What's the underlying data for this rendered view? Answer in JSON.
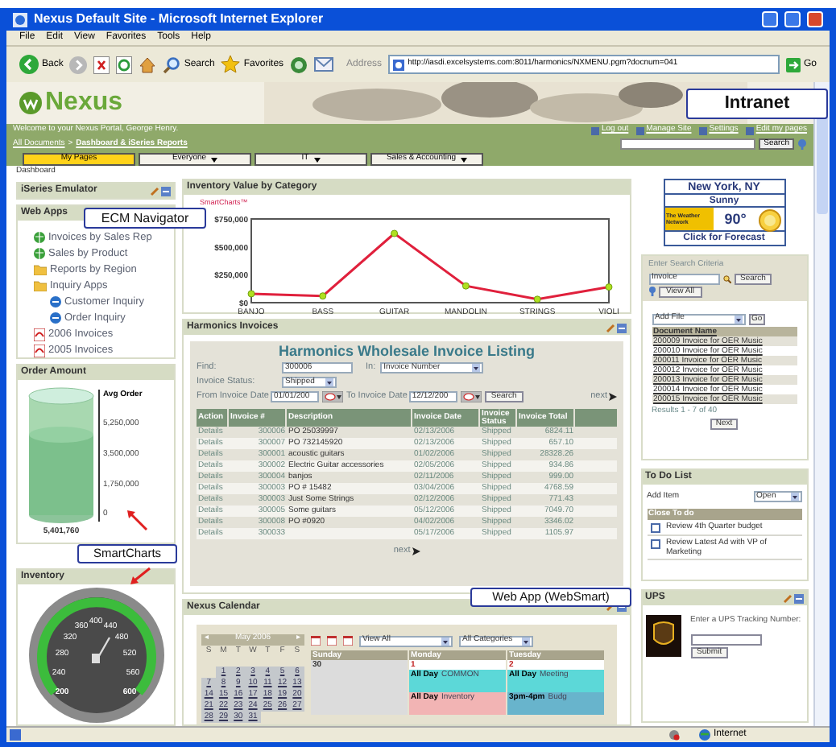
{
  "window": {
    "title": "Nexus Default Site - Microsoft Internet Explorer"
  },
  "menu": [
    "File",
    "Edit",
    "View",
    "Favorites",
    "Tools",
    "Help"
  ],
  "toolbar": {
    "back": "Back",
    "search": "Search",
    "favorites": "Favorites",
    "address_label": "Address",
    "address": "http://iasdi.excelsystems.com:8011/harmonics/NXMENU.pgm?docnum=041",
    "go": "Go"
  },
  "banner": {
    "logo": "Nexus",
    "callout": "Intranet"
  },
  "portal_bar": {
    "welcome": "Welcome to your Nexus Portal, George Henry.",
    "links": [
      "Log out",
      "Manage Site",
      "Settings",
      "Edit my pages"
    ],
    "breadcrumb": [
      "All Documents",
      ">",
      "Dashboard & iSeries Reports"
    ],
    "search_button": "Search"
  },
  "tabs": [
    {
      "label": "My Pages",
      "selected": true,
      "dropdown": false
    },
    {
      "label": "Everyone",
      "selected": false,
      "dropdown": true
    },
    {
      "label": "IT",
      "selected": false,
      "dropdown": true
    },
    {
      "label": "Sales & Accounting",
      "selected": false,
      "dropdown": true
    }
  ],
  "left": {
    "dashboard_label": "Dashboard",
    "iseries_title": "iSeries Emulator",
    "callout": "ECM Navigator",
    "web_apps": {
      "title": "Web Apps",
      "items": [
        {
          "label": "Invoices by Sales Rep",
          "kind": "globe"
        },
        {
          "label": "Sales by Product",
          "kind": "globe"
        },
        {
          "label": "Reports by Region",
          "kind": "folder"
        },
        {
          "label": "Inquiry Apps",
          "kind": "folder",
          "children": [
            {
              "label": "Customer Inquiry",
              "kind": "app"
            },
            {
              "label": "Order Inquiry",
              "kind": "app"
            }
          ]
        },
        {
          "label": "2006 Invoices",
          "kind": "pdf"
        },
        {
          "label": "2005 Invoices",
          "kind": "pdf"
        }
      ]
    },
    "order_amount": {
      "title": "Order Amount",
      "axis_title": "Avg Order",
      "ticks": [
        "5,250,000",
        "3,500,000",
        "1,750,000",
        "0"
      ],
      "value": "5,401,760"
    },
    "smartcharts_callout": "SmartCharts",
    "inventory": {
      "title": "Inventory",
      "gauge_labels": [
        "400",
        "360",
        "440",
        "320",
        "480",
        "280",
        "520",
        "240",
        "560",
        "200",
        "600"
      ]
    }
  },
  "inventory_chart": {
    "title": "Inventory Value by Category",
    "brand": "SmartCharts™",
    "chart_data": {
      "type": "line",
      "categories": [
        "BANJO",
        "BASS",
        "GUITAR",
        "MANDOLIN",
        "STRINGS",
        "VIOLI"
      ],
      "series": [
        {
          "color": "#e0203c",
          "marker": "circle",
          "values": [
            80000,
            60000,
            620000,
            150000,
            30000,
            140000
          ]
        }
      ],
      "ylim": [
        0,
        750000
      ],
      "yticks": [
        {
          "value": 0,
          "label": "$0"
        },
        {
          "value": 250000,
          "label": "$250,000"
        },
        {
          "value": 500000,
          "label": "$500,000"
        },
        {
          "value": 750000,
          "label": "$750,000"
        }
      ]
    }
  },
  "invoices": {
    "panel_title": "Harmonics Invoices",
    "heading": "Harmonics Wholesale Invoice Listing",
    "find_label": "Find:",
    "find_value": "300006",
    "in_label": "In:",
    "in_value": "Invoice Number",
    "status_label": "Invoice Status:",
    "status_value": "Shipped",
    "from_label": "From Invoice Date",
    "from_value": "01/01/200",
    "to_label": "To Invoice Date",
    "to_value": "12/12/200",
    "search_button": "Search",
    "next": "next",
    "columns": [
      "Action",
      "Invoice #",
      "Description",
      "Invoice Date",
      "Invoice Status",
      "Invoice Total"
    ],
    "rows": [
      [
        "Details",
        "300006",
        "PO 25039997",
        "02/13/2006",
        "Shipped",
        "6824.11"
      ],
      [
        "Details",
        "300007",
        "PO 732145920",
        "02/13/2006",
        "Shipped",
        "657.10"
      ],
      [
        "Details",
        "300001",
        "acoustic guitars",
        "01/02/2006",
        "Shipped",
        "28328.26"
      ],
      [
        "Details",
        "300002",
        "Electric Guitar accessories",
        "02/05/2006",
        "Shipped",
        "934.86"
      ],
      [
        "Details",
        "300004",
        "banjos",
        "02/11/2006",
        "Shipped",
        "999.00"
      ],
      [
        "Details",
        "300003",
        "PO # 15482",
        "03/04/2006",
        "Shipped",
        "4768.59"
      ],
      [
        "Details",
        "300003",
        "Just Some Strings",
        "02/12/2006",
        "Shipped",
        "771.43"
      ],
      [
        "Details",
        "300005",
        "Some guitars",
        "05/12/2006",
        "Shipped",
        "7049.70"
      ],
      [
        "Details",
        "300008",
        "PO #0920",
        "04/02/2006",
        "Shipped",
        "3346.02"
      ],
      [
        "Details",
        "300033",
        "",
        "05/17/2006",
        "Shipped",
        "1105.97"
      ]
    ],
    "next_bottom": "next",
    "callout": "Web App (WebSmart)"
  },
  "calendar": {
    "title": "Nexus Calendar",
    "month": "May 2006",
    "prev": "◂",
    "next": "▸",
    "weekdays": [
      "S",
      "M",
      "T",
      "W",
      "T",
      "F",
      "S"
    ],
    "weeks": [
      [
        "1",
        "2",
        "3",
        "4",
        "5",
        "6"
      ],
      [
        "7",
        "8",
        "9",
        "10",
        "11",
        "12",
        "13"
      ],
      [
        "14",
        "15",
        "16",
        "17",
        "18",
        "19",
        "20"
      ],
      [
        "21",
        "22",
        "23",
        "24",
        "25",
        "26",
        "27"
      ],
      [
        "28",
        "29",
        "30",
        "31"
      ]
    ],
    "view_select": "View All",
    "category_select": "All Categories",
    "days": [
      {
        "name": "Sunday",
        "date": "30"
      },
      {
        "name": "Monday",
        "date": "1",
        "events": [
          {
            "time": "All Day",
            "text": "COMMON",
            "color": "#5cd8d8"
          },
          {
            "time": "All Day",
            "text": "Inventory",
            "color": "#f2b4b4"
          }
        ]
      },
      {
        "name": "Tuesday",
        "date": "2",
        "events": [
          {
            "time": "All Day",
            "text": "Meeting",
            "color": "#5cd8d8"
          },
          {
            "time": "3pm-4pm",
            "text": "Budg",
            "color": "#68b4cc"
          }
        ]
      }
    ]
  },
  "weather": {
    "city": "New York, NY",
    "condition": "Sunny",
    "provider": "The Weather Network",
    "temperature": "90°",
    "link": "Click for Forecast"
  },
  "documents": {
    "criteria_label": "Enter Search Criteria",
    "search_value": "Invoice",
    "search_button": "Search",
    "view_all": "View All",
    "add_select": "Add File",
    "go": "Go",
    "column": "Document Name",
    "rows": [
      "200009 Invoice for OER Music",
      "200010 Invoice for OER Music",
      "200011 Invoice for OER Music",
      "200012 Invoice for OER Music",
      "200013 Invoice for OER Music",
      "200014 Invoice for OER Music",
      "200015 Invoice for OER Music"
    ],
    "results": "Results 1 - 7 of 40",
    "next": "Next"
  },
  "todo": {
    "title": "To Do List",
    "add_item": "Add Item",
    "filter": "Open",
    "header": "Close To do",
    "items": [
      {
        "text": "Review 4th Quarter budget",
        "checked": false
      },
      {
        "text": "Review Latest Ad with VP of Marketing",
        "checked": false
      }
    ]
  },
  "ups": {
    "title": "UPS",
    "prompt": "Enter a UPS Tracking Number:",
    "submit": "Submit"
  },
  "status_bar": {
    "zone": "Internet"
  }
}
